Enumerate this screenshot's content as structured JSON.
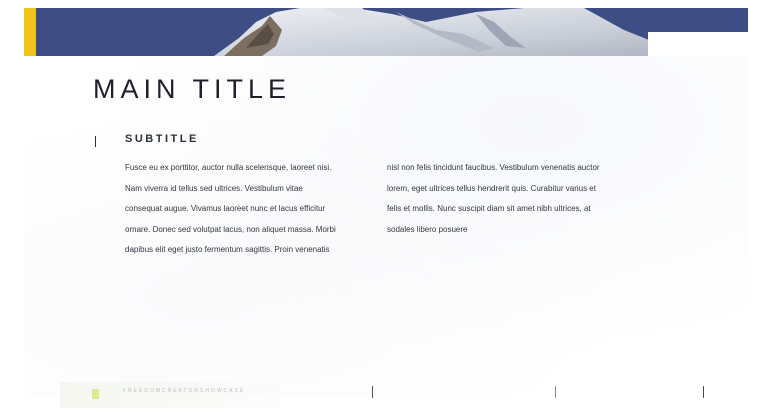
{
  "slide": {
    "title": "MAIN TITLE",
    "subtitle": "SUBTITLE",
    "body": {
      "column_1": [
        "Fusce eu ex porttitor, auctor nulla scelerisque, laoreet nisi.",
        "Nam viverra id tellus sed ultrices. Vestibulum vitae",
        "consequat augue. Vivamus laoreet nunc et lacus efficitur",
        "ornare. Donec sed volutpat lacus, non aliquet massa. Morbi",
        "dapibus elit eget justo fermentum sagittis. Proin venenatis"
      ],
      "column_2": [
        "nisl non felis tincidunt faucibus. Vestibulum venenatis auctor",
        "lorem, eget ultrices tellus hendrerit quis. Curabitur varius et",
        "felis et mollis. Nunc suscipit diam sit amet nibh ultrices, at",
        "sodales libero posuere"
      ]
    },
    "footer": {
      "text": "FREEDOMCREATORSHOWCASE"
    }
  },
  "colors": {
    "banner": "#3f4d85",
    "accent": "#f2c31b",
    "footer_logo": "#dfe88f"
  },
  "icons": {
    "footer_logo": "footer-logo-icon"
  }
}
